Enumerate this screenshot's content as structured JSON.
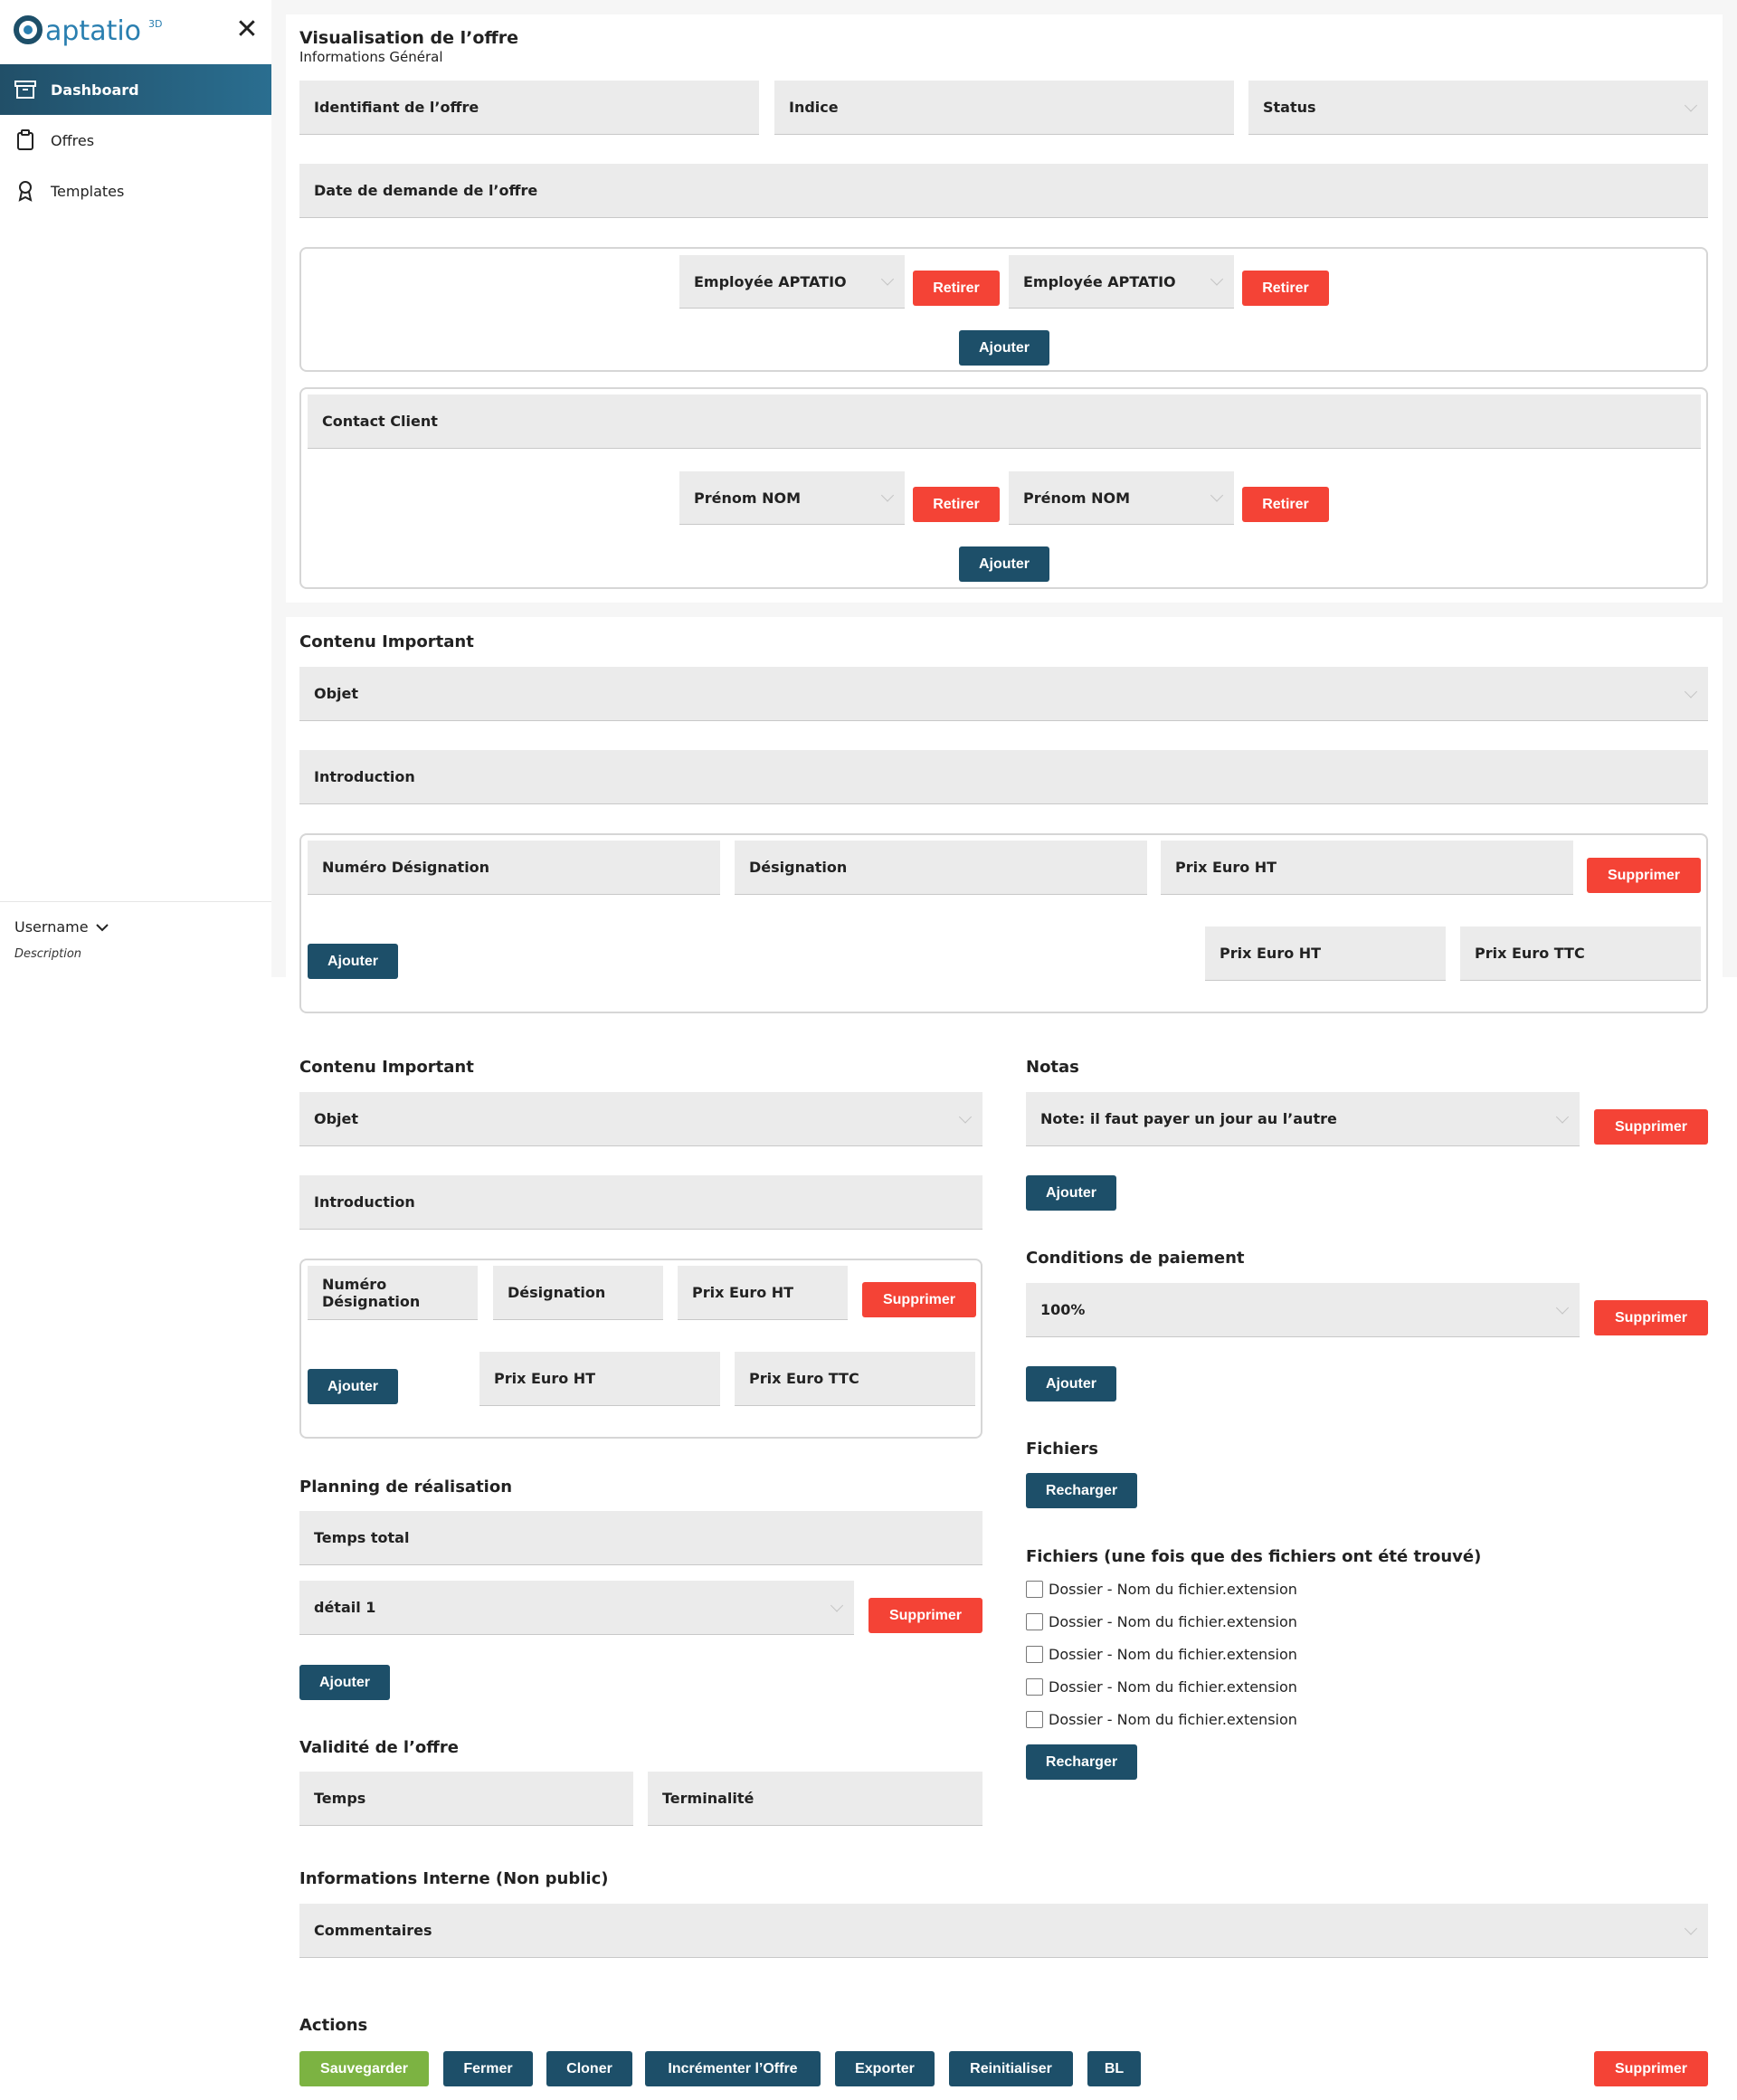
{
  "sidebar": {
    "logo_text": "aptatio",
    "logo_sup": "3D",
    "items": [
      {
        "label": "Dashboard",
        "icon": "archive-icon"
      },
      {
        "label": "Offres",
        "icon": "clipboard-icon"
      },
      {
        "label": "Templates",
        "icon": "award-icon"
      }
    ],
    "username": "Username",
    "description": "Description"
  },
  "header": {
    "title": "Visualisation de l’offre",
    "subtitle": "Informations Général"
  },
  "general": {
    "identifiant": "Identifiant de l’offre",
    "indice": "Indice",
    "status": "Status",
    "date": "Date de demande de l’offre",
    "employees": [
      "Employée APTATIO",
      "Employée APTATIO"
    ],
    "retirer": "Retirer",
    "ajouter": "Ajouter",
    "contact_label": "Contact Client",
    "contacts": [
      "Prénom NOM",
      "Prénom NOM"
    ]
  },
  "contenu1": {
    "title": "Contenu Important",
    "objet": "Objet",
    "introduction": "Introduction",
    "numero": "Numéro Désignation",
    "designation": "Désignation",
    "prix_ht": "Prix Euro HT",
    "prix_ttc": "Prix Euro TTC",
    "supprimer": "Supprimer",
    "ajouter": "Ajouter"
  },
  "contenu2": {
    "title": "Contenu Important",
    "objet": "Objet",
    "introduction": "Introduction",
    "numero": "Numéro Désignation",
    "designation": "Désignation",
    "prix_ht": "Prix Euro HT",
    "prix_ttc": "Prix Euro TTC",
    "supprimer": "Supprimer",
    "ajouter": "Ajouter"
  },
  "planning": {
    "title": "Planning de réalisation",
    "temps_total": "Temps total",
    "detail": "détail 1",
    "supprimer": "Supprimer",
    "ajouter": "Ajouter"
  },
  "validite": {
    "title": "Validité de l’offre",
    "temps": "Temps",
    "terminalite": "Terminalité"
  },
  "notas": {
    "title": "Notas",
    "note": "Note: il faut payer un jour au l’autre",
    "supprimer": "Supprimer",
    "ajouter": "Ajouter"
  },
  "paiement": {
    "title": "Conditions de paiement",
    "value": "100%",
    "supprimer": "Supprimer",
    "ajouter": "Ajouter"
  },
  "fichiers": {
    "title": "Fichiers",
    "recharger": "Recharger",
    "title2": "Fichiers (une fois que des fichiers ont été trouvé)",
    "files": [
      "Dossier - Nom du fichier.extension",
      "Dossier - Nom du fichier.extension",
      "Dossier - Nom du fichier.extension",
      "Dossier - Nom du fichier.extension",
      "Dossier - Nom du fichier.extension"
    ],
    "recharger2": "Recharger"
  },
  "interne": {
    "title": "Informations Interne (Non public)",
    "commentaires": "Commentaires"
  },
  "actions": {
    "title": "Actions",
    "sauvegarder": "Sauvegarder",
    "fermer": "Fermer",
    "cloner": "Cloner",
    "incrementer": "Incrémenter l’Offre",
    "exporter": "Exporter",
    "reinitialiser": "Reinitialiser",
    "bl": "BL",
    "supprimer": "Supprimer"
  }
}
